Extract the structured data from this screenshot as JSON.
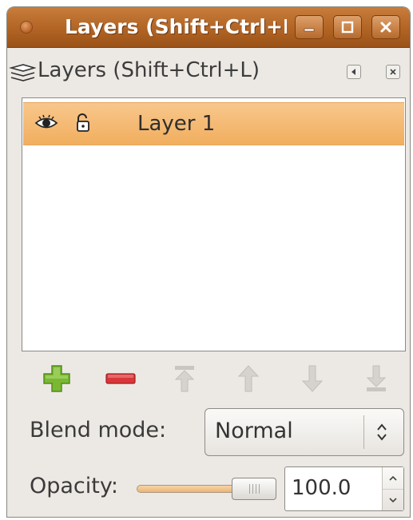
{
  "window": {
    "title": "Layers (Shift+Ctrl+L)"
  },
  "panel": {
    "title": "Layers (Shift+Ctrl+L)"
  },
  "layers": [
    {
      "name": "Layer 1",
      "visible": true,
      "locked": false,
      "selected": true
    }
  ],
  "toolbar": {
    "icons": [
      "add-layer-icon",
      "remove-layer-icon",
      "raise-to-top-icon",
      "raise-layer-icon",
      "lower-layer-icon",
      "lower-to-bottom-icon"
    ]
  },
  "blend": {
    "label": "Blend mode:",
    "value": "Normal"
  },
  "opacity": {
    "label": "Opacity:",
    "value": "100.0",
    "fraction": 1.0
  },
  "colors": {
    "titlebar": "#b16424",
    "selection": "#f1ae5e",
    "add": "#7ab832",
    "remove": "#d9363a"
  }
}
